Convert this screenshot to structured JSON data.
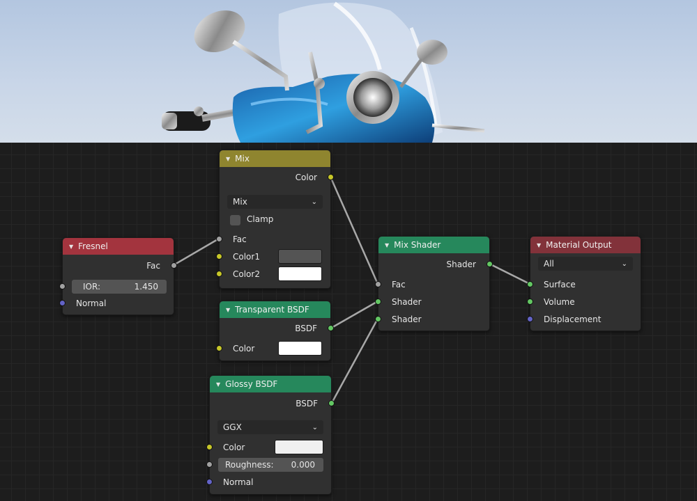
{
  "nodes": {
    "mix": {
      "title": "Mix",
      "output_color": "Color",
      "blend_mode": "Mix",
      "clamp_label": "Clamp",
      "input_fac": "Fac",
      "input_color1": "Color1",
      "input_color2": "Color2",
      "color1_value": "#545454",
      "color2_value": "#ffffff"
    },
    "fresnel": {
      "title": "Fresnel",
      "output_fac": "Fac",
      "ior_label": "IOR:",
      "ior_value": "1.450",
      "input_normal": "Normal"
    },
    "transparent": {
      "title": "Transparent BSDF",
      "output_bsdf": "BSDF",
      "input_color": "Color",
      "color_value": "#ffffff"
    },
    "glossy": {
      "title": "Glossy BSDF",
      "output_bsdf": "BSDF",
      "distribution": "GGX",
      "input_color": "Color",
      "color_value": "#f0f0f0",
      "roughness_label": "Roughness:",
      "roughness_value": "0.000",
      "input_normal": "Normal"
    },
    "mix_shader": {
      "title": "Mix Shader",
      "output_shader": "Shader",
      "input_fac": "Fac",
      "input_shader1": "Shader",
      "input_shader2": "Shader"
    },
    "material_output": {
      "title": "Material Output",
      "target": "All",
      "input_surface": "Surface",
      "input_volume": "Volume",
      "input_displacement": "Displacement"
    }
  },
  "icons": {
    "collapse": "triangle-down-icon",
    "dropdown": "chevron-down-icon"
  },
  "colors": {
    "header_input": "#8f852f",
    "header_texture": "#a3343e",
    "header_shader": "#26885c",
    "header_output": "#82323a",
    "socket_float": "#a1a1a1",
    "socket_color": "#c7c729",
    "socket_shader": "#63c763",
    "socket_vector": "#6363c7"
  }
}
